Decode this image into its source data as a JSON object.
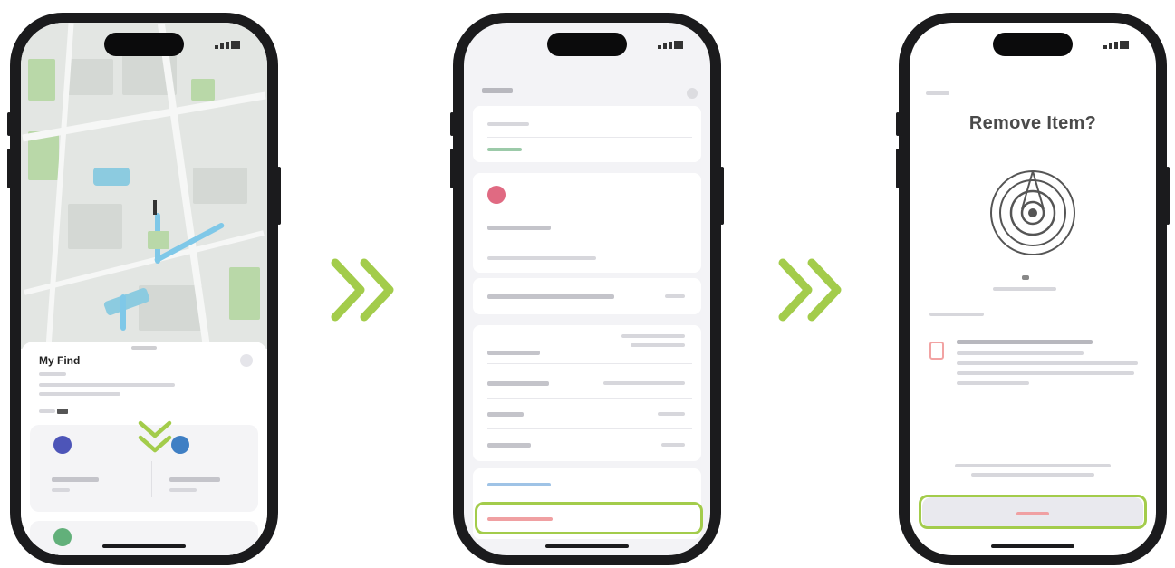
{
  "colors": {
    "accent_green": "#a3cc4b",
    "destructive_red": "#e5484d",
    "link_blue": "#3b8ed6"
  },
  "icons": [
    "double-chevron-right-icon",
    "double-chevron-down-icon",
    "airtag-icon"
  ],
  "step1": {
    "title": "My Find"
  },
  "step3": {
    "title": "Remove Item?"
  }
}
